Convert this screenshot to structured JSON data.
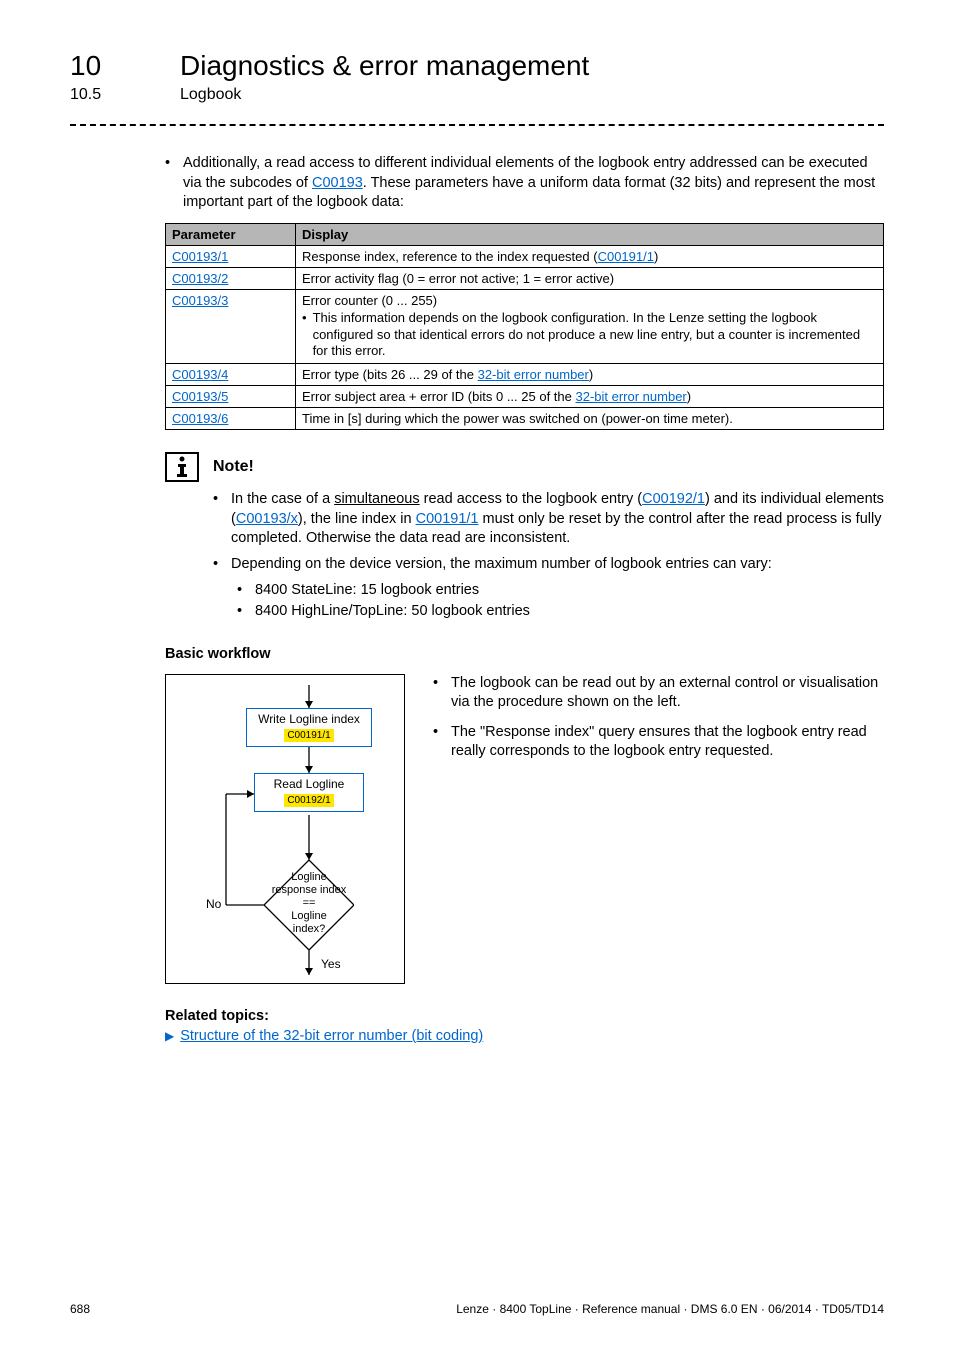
{
  "header": {
    "chapter_num": "10",
    "chapter_title": "Diagnostics & error management",
    "section_num": "10.5",
    "section_title": "Logbook"
  },
  "intro": {
    "bullet": "Additionally, a read access to different individual elements of the logbook entry addressed can be executed via the subcodes of ",
    "link": "C00193",
    "after": ". These parameters have a uniform data format (32 bits) and represent the most important part of the logbook data:"
  },
  "table": {
    "headers": [
      "Parameter",
      "Display"
    ],
    "rows": [
      {
        "param": "C00193/1",
        "display_pre": "Response index, reference to the index requested (",
        "display_link": "C00191/1",
        "display_post": ")"
      },
      {
        "param": "C00193/2",
        "display_pre": "Error activity flag (0 = error not active; 1 = error active)",
        "display_link": "",
        "display_post": ""
      },
      {
        "param": "C00193/3",
        "display_pre": "Error counter (0 ... 255)",
        "sub_bullet": "This information depends on the logbook configuration. In the Lenze setting the logbook configured so that identical errors do not produce a new line entry, but a counter is incremented for this error."
      },
      {
        "param": "C00193/4",
        "display_pre": "Error type (bits 26 ... 29 of the ",
        "display_link": "32-bit error number",
        "display_post": ")"
      },
      {
        "param": "C00193/5",
        "display_pre": "Error subject area + error ID (bits 0 ... 25 of the ",
        "display_link": "32-bit error number",
        "display_post": ")"
      },
      {
        "param": "C00193/6",
        "display_pre": "Time in [s] during which the power was switched on (power-on time meter).",
        "display_link": "",
        "display_post": ""
      }
    ]
  },
  "note": {
    "title": "Note!",
    "b1_pre": "In the case of a ",
    "b1_underline": "simultaneous",
    "b1_mid1": " read access to the logbook entry (",
    "b1_link1": "C00192/1",
    "b1_mid2": ") and its individual elements (",
    "b1_link2": "C00193/x",
    "b1_mid3": "), the line index in ",
    "b1_link3": "C00191/1",
    "b1_post": " must only be reset by the control after the read process is fully completed. Otherwise the data read are inconsistent.",
    "b2": "Depending on the device version, the maximum number of logbook entries can vary:",
    "b2_sub1": "8400 StateLine: 15 logbook entries",
    "b2_sub2": "8400 HighLine/TopLine: 50 logbook entries"
  },
  "workflow": {
    "title": "Basic workflow",
    "box1_label": "Write Logline index",
    "box1_code": "C00191/1",
    "box2_label": "Read Logline",
    "box2_code": "C00192/1",
    "diamond_l1": "Logline",
    "diamond_l2": "response index",
    "diamond_l3": "==",
    "diamond_l4": "Logline",
    "diamond_l5": "index?",
    "no": "No",
    "yes": "Yes",
    "text1": "The logbook can be read out by an external control or visualisation via the procedure shown on the left.",
    "text2": "The \"Response index\" query ensures that the logbook entry read really corresponds to the logbook entry requested."
  },
  "related": {
    "title": "Related topics:",
    "link": "Structure of the 32-bit error number (bit coding)"
  },
  "footer": {
    "page": "688",
    "doc": "Lenze · 8400 TopLine · Reference manual · DMS 6.0 EN · 06/2014 · TD05/TD14"
  }
}
